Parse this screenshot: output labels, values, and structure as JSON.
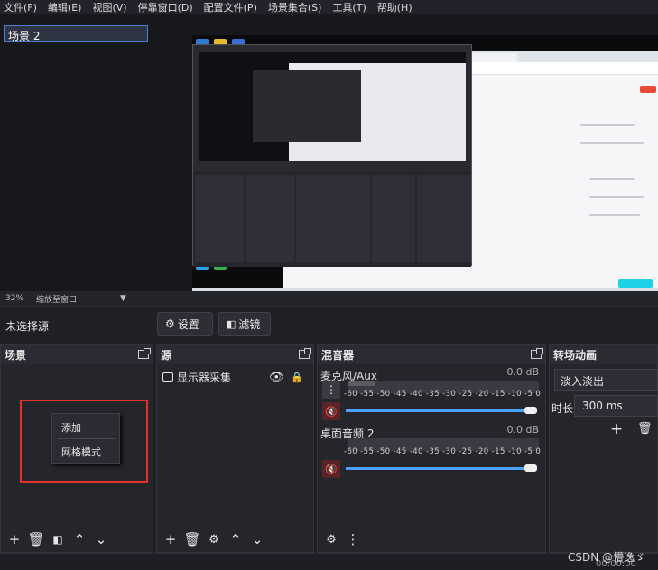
{
  "menubar": {
    "items": [
      "文件(F)",
      "编辑(E)",
      "视图(V)",
      "停靠窗口(D)",
      "配置文件(P)",
      "场景集合(S)",
      "工具(T)",
      "帮助(H)"
    ]
  },
  "statusstrip": {
    "zoom": "32%",
    "fit": "缩放至窗口"
  },
  "sourcebar": {
    "no_source": "未选择源",
    "settings": "设置",
    "filters": "滤镜"
  },
  "docks": {
    "scenes": {
      "title": "场景",
      "item": "场景 2"
    },
    "context_menu": {
      "add": "添加",
      "grid": "网格模式"
    },
    "sources": {
      "title": "源",
      "item": "显示器采集"
    },
    "mixer": {
      "title": "混音器",
      "channels": [
        {
          "name": "麦克风/Aux",
          "db": "0.0 dB",
          "level": 0.14
        },
        {
          "name": "桌面音频 2",
          "db": "0.0 dB",
          "level": 0.0
        }
      ],
      "ticks": "-60 -55 -50 -45 -40 -35 -30 -25 -20 -15 -10  -5   0"
    },
    "transitions": {
      "title": "转场动画",
      "selected": "淡入淡出",
      "duration_label": "时长",
      "duration_value": "300 ms"
    }
  },
  "watermark": "CSDN @懵逸ゞ",
  "clock": "00:00:00",
  "colors": {
    "accent": "#4aa3ff",
    "highlight_box": "#e8312a",
    "selected_border": "#4a7fd1"
  }
}
